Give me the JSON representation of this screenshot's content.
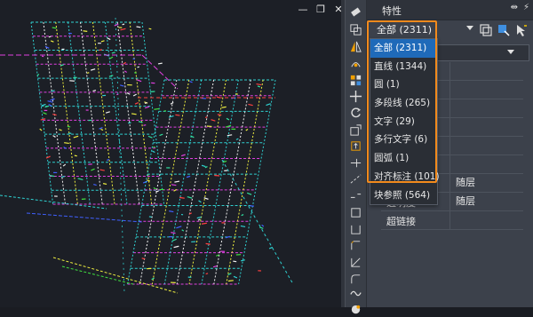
{
  "window_controls": {
    "minimize": "—",
    "restore": "❐",
    "close": "✕"
  },
  "panel": {
    "title": "特性",
    "pin_label": "⇹",
    "menu_label": "⚡"
  },
  "selector": {
    "current": "全部 (2311)",
    "options": [
      "全部 (2311)",
      "直线 (1344)",
      "圆 (1)",
      "多段线 (265)",
      "文字 (29)",
      "多行文字 (6)",
      "圆弧 (1)",
      "对齐标注 (101)",
      "块参照 (564)"
    ],
    "selected_index": 0
  },
  "properties": [
    {
      "label": "",
      "value": ""
    },
    {
      "label": "",
      "value": ""
    },
    {
      "label": "",
      "value": ""
    },
    {
      "label": "",
      "value": ""
    },
    {
      "label": "",
      "value": ""
    },
    {
      "label": "",
      "value": ""
    },
    {
      "label": "",
      "value": "随层"
    },
    {
      "label": "透明度",
      "value": "随层"
    },
    {
      "label": "超链接",
      "value": ""
    }
  ],
  "toolbar_icons": [
    "eraser-icon",
    "copy-icon",
    "mirror-icon",
    "offset-icon",
    "array-icon",
    "move-icon",
    "rotate-icon",
    "scale-icon",
    "stretch-icon",
    "trim-icon",
    "extend-icon",
    "break-icon",
    "break-at-point-icon",
    "join-icon",
    "chamfer-icon",
    "fillet-icon",
    "spline-icon",
    "explode-icon"
  ],
  "colors": {
    "highlight": "#f28a1c",
    "selected_option": "#1f6ab9"
  }
}
